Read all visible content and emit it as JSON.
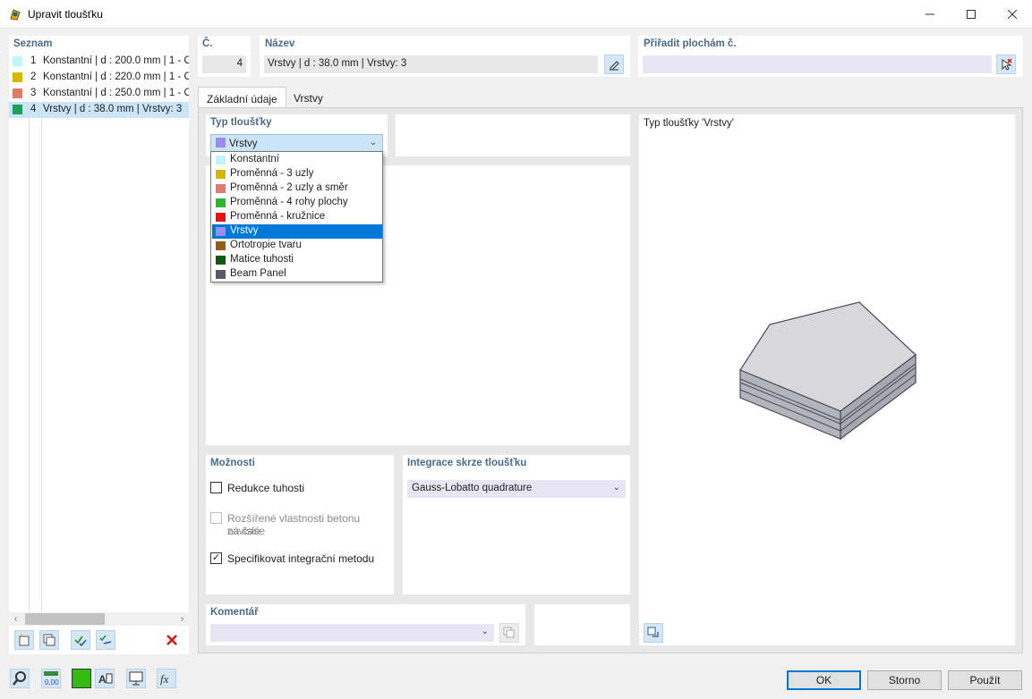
{
  "window": {
    "title": "Upravit tloušťku"
  },
  "list": {
    "title": "Seznam",
    "items": [
      {
        "num": "1",
        "text": "Konstantní | d : 200.0 mm | 1 - C",
        "color": "#bff7f9"
      },
      {
        "num": "2",
        "text": "Konstantní | d : 220.0 mm | 1 - C",
        "color": "#d4b800"
      },
      {
        "num": "3",
        "text": "Konstantní | d : 250.0 mm | 1 - C",
        "color": "#e07a6c"
      },
      {
        "num": "4",
        "text": "Vrstvy | d : 38.0 mm | Vrstvy: 3",
        "color": "#21a05a"
      }
    ]
  },
  "header": {
    "number_label": "Č.",
    "number_value": "4",
    "name_label": "Název",
    "name_value": "Vrstvy | d : 38.0 mm | Vrstvy: 3",
    "assign_label": "Přiřadit plochám č.",
    "assign_value": ""
  },
  "tabs": [
    {
      "label": "Základní údaje"
    },
    {
      "label": "Vrstvy"
    }
  ],
  "thickness_type": {
    "title": "Typ tloušťky",
    "selected": "Vrstvy",
    "selected_color": "#9a8cf0",
    "options": [
      {
        "label": "Konstantní",
        "color": "#bff7f9"
      },
      {
        "label": "Proměnná - 3 uzly",
        "color": "#d4b800"
      },
      {
        "label": "Proměnná - 2 uzly a směr",
        "color": "#e07a6c"
      },
      {
        "label": "Proměnná - 4 rohy plochy",
        "color": "#2db82d"
      },
      {
        "label": "Proměnná - kružnice",
        "color": "#ee1111"
      },
      {
        "label": "Vrstvy",
        "color": "#9a8cf0"
      },
      {
        "label": "Ortotropie tvaru",
        "color": "#9a5a1a"
      },
      {
        "label": "Matice tuhosti",
        "color": "#0e5a0e"
      },
      {
        "label": "Beam Panel",
        "color": "#5a5a64"
      }
    ],
    "highlighted_index": 5
  },
  "options": {
    "title": "Možnosti",
    "stiffness_reduction": {
      "label": "Redukce tuhosti",
      "checked": false
    },
    "concrete_props": {
      "label_line1": "Rozšířené vlastnosti betonu závislé",
      "label_line2": "na čase",
      "checked": false
    },
    "specify_integration": {
      "label": "Specifikovat integrační metodu",
      "checked": true
    }
  },
  "integration": {
    "title": "Integrace skrze tloušťku",
    "value": "Gauss-Lobatto quadrature"
  },
  "comment": {
    "title": "Komentář",
    "value": ""
  },
  "preview": {
    "title": "Typ tloušťky  'Vrstvy'"
  },
  "buttons": {
    "ok": "OK",
    "cancel": "Storno",
    "apply": "Použít"
  },
  "status_color": "#33bb11"
}
